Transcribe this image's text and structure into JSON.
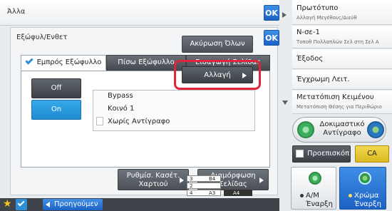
{
  "topbar": {
    "title": "Άλλα",
    "ok_label": "OK"
  },
  "dialog": {
    "title": "Εξώφυλ/Ενθετ",
    "ok_label": "OK",
    "cancel_all_label": "Ακύρωση Όλων",
    "tabs": [
      {
        "label": "Εμπρός Εξώφυλλο",
        "active": true
      },
      {
        "label": "Πίσω Εξώφυλλο",
        "active": false
      },
      {
        "label": "Εισαγωγή Σελίδας",
        "active": false
      }
    ],
    "toggle_off_label": "Off",
    "toggle_on_label": "On",
    "selected_toggle": "On",
    "paper": {
      "tray": "Bypass",
      "type": "Κοινό 1",
      "print_mode": "Χωρίς Αντίγραφο"
    },
    "change_label": "Αλλαγή",
    "tray_settings_label": "Ρυθμίσ. Κασέτ. Χαρτιού",
    "page_layout_label": "Διαμόρφωση Σελίδας"
  },
  "right_menu": [
    {
      "label": "Πρωτότυπο",
      "sub": "Αλλαγή Μεγέθους/Διεύθ"
    },
    {
      "label": "Ν-σε-1",
      "sub": "Τοποθ Πολλαπλών Σελ στη Σελ Α"
    },
    {
      "label": "Έξοδος",
      "sub": ""
    },
    {
      "label": "Έγχρωμη Λειτ.",
      "sub": ""
    },
    {
      "label": "Μετατόπιση Κειμένου",
      "sub": "Μετατόπιση Θέσης για Περιθώριο"
    }
  ],
  "test_copy_label": "Δοκιμαστικό Αντίγραφο",
  "preview_label": "Προεπισκόπ",
  "ca_label": "CA",
  "start_bw": {
    "line1": "Α/Μ",
    "line2": "Έναρξη"
  },
  "start_color": {
    "line1": "Χρώμα",
    "line2": "Έναρξη"
  },
  "bottombar": {
    "prev_label": "Προηγούμεν"
  },
  "trays": [
    {
      "num": "3",
      "size": "B4"
    },
    {
      "num": "2",
      "size": ""
    },
    {
      "num": "4",
      "size": "A3"
    },
    {
      "num": "",
      "size": "A4"
    }
  ],
  "colors": {
    "accent_blue": "#1c62c4",
    "highlight_red": "#e0243a",
    "ca_yellow": "#e6c835"
  }
}
